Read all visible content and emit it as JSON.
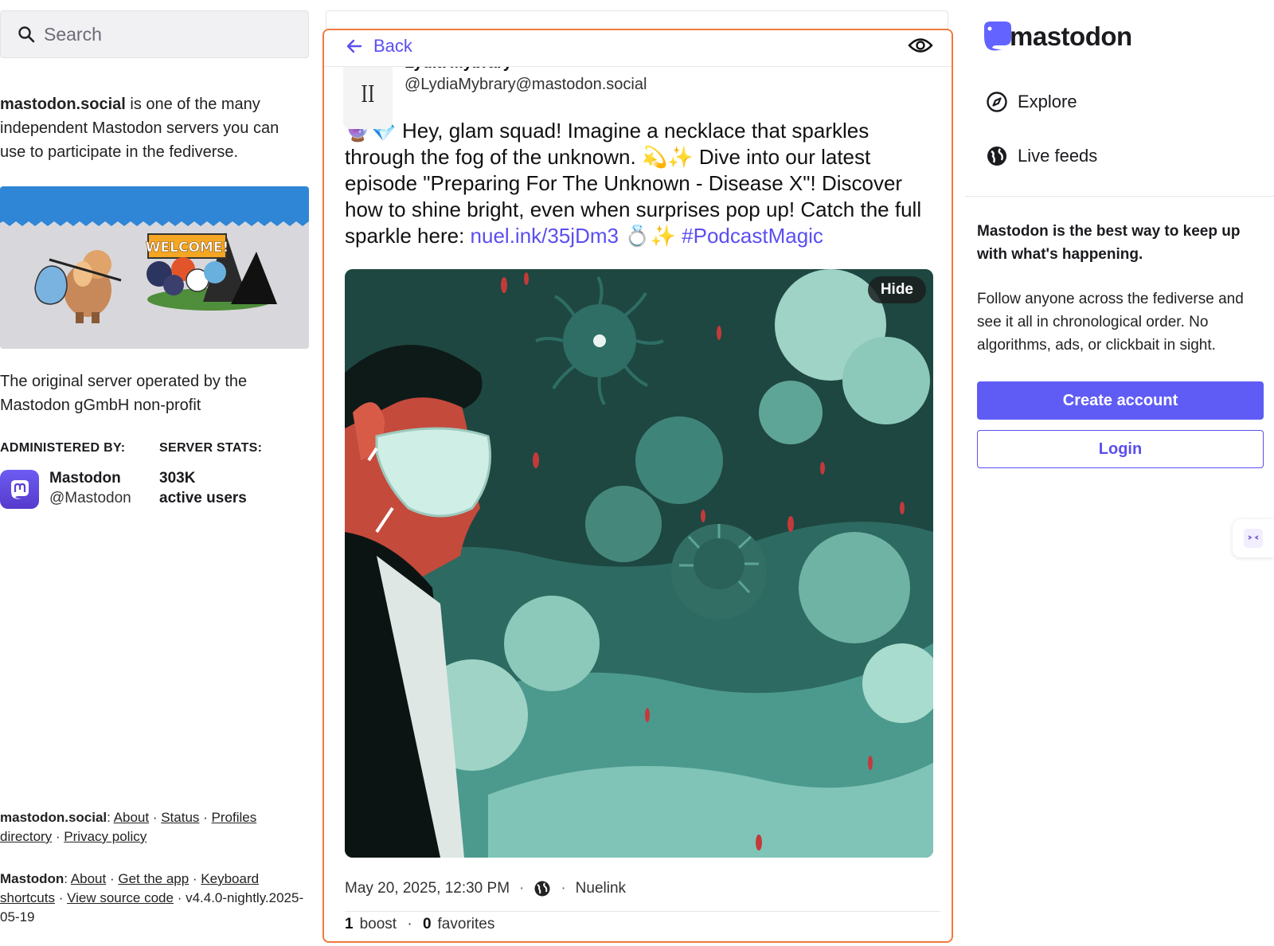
{
  "search": {
    "placeholder": "Search"
  },
  "about": {
    "server_name": "mastodon.social",
    "text": " is one of the many independent Mastodon servers you can use to participate in the fediverse."
  },
  "hero": {
    "banner_text": "WELCOME!"
  },
  "server_description": "The original server operated by the Mastodon gGmbH non-profit",
  "admin": {
    "heading": "ADMINISTERED BY:",
    "name": "Mastodon",
    "handle": "@Mastodon"
  },
  "stats": {
    "heading": "SERVER STATS:",
    "value": "303K",
    "label": "active users"
  },
  "footer": {
    "server_label": "mastodon.social",
    "server_links": [
      "About",
      "Status",
      "Profiles directory",
      "Privacy policy"
    ],
    "mastodon_label": "Mastodon",
    "mastodon_links": [
      "About",
      "Get the app",
      "Keyboard shortcuts",
      "View source code"
    ],
    "version": "v4.4.0-nightly.2025-05-19"
  },
  "post_view": {
    "back_label": "Back",
    "author_name": "Lydia Mybrary",
    "author_handle": "@LydiaMybrary@mastodon.social",
    "text_part1": "🔮💎 Hey, glam squad! Imagine a necklace that sparkles through the fog of the unknown. 💫✨ Dive into our latest episode \"Preparing For The Unknown - Disease X\"! Discover how to shine bright, even when surprises pop up! Catch the full sparkle here: ",
    "link": "nuel.ink/35jDm3",
    "text_part2": " 💍✨ ",
    "hashtag": "#PodcastMagic",
    "hide_label": "Hide",
    "date": "May 20, 2025, 12:30 PM",
    "app": "Nuelink",
    "boost_count": "1",
    "boost_label": "boost",
    "favorite_count": "0",
    "favorite_label": "favorites"
  },
  "right": {
    "logo_text": "mastodon",
    "nav": [
      {
        "label": "Explore",
        "icon": "compass-icon"
      },
      {
        "label": "Live feeds",
        "icon": "globe-icon"
      }
    ],
    "promo_title": "Mastodon is the best way to keep up with what's happening.",
    "promo_body": "Follow anyone across the fediverse and see it all in chronological order. No algorithms, ads, or clickbait in sight.",
    "create_account": "Create account",
    "login": "Login"
  },
  "colors": {
    "accent": "#5b4ef0",
    "focus_border": "#f07a3c"
  }
}
